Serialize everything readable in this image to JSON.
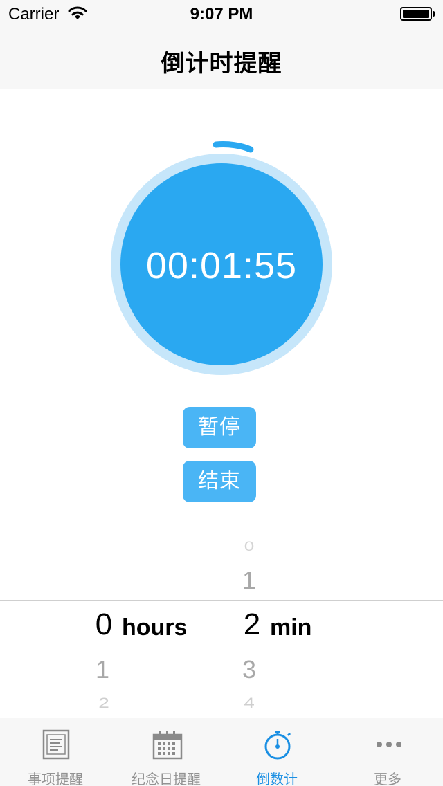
{
  "status_bar": {
    "carrier": "Carrier",
    "time": "9:07 PM"
  },
  "nav": {
    "title": "倒计时提醒"
  },
  "timer": {
    "display": "00:01:55",
    "accent_color": "#2aa8f1"
  },
  "buttons": {
    "pause": "暂停",
    "stop": "结束"
  },
  "picker": {
    "hours": {
      "above": [],
      "selected": "0",
      "below": [
        "1",
        "2"
      ],
      "unit": "hours"
    },
    "minutes": {
      "above": [
        "0",
        "1"
      ],
      "selected": "2",
      "below": [
        "3",
        "4"
      ],
      "unit": "min"
    }
  },
  "tabs": [
    {
      "label": "事项提醒",
      "icon": "list-doc-icon",
      "active": false
    },
    {
      "label": "纪念日提醒",
      "icon": "calendar-icon",
      "active": false
    },
    {
      "label": "倒数计",
      "icon": "stopwatch-icon",
      "active": true
    },
    {
      "label": "更多",
      "icon": "more-dots-icon",
      "active": false
    }
  ]
}
